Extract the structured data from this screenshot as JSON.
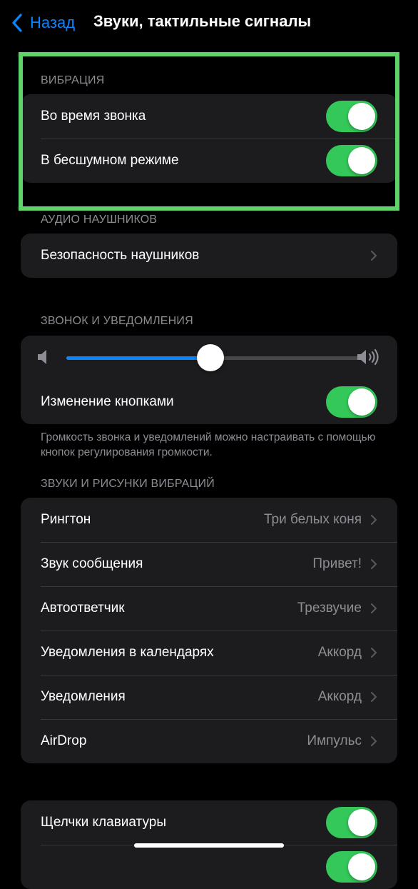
{
  "nav": {
    "back_label": "Назад",
    "title": "Звуки, тактильные сигналы"
  },
  "vibration": {
    "header": "ВИБРАЦИЯ",
    "items": [
      {
        "label": "Во время звонка",
        "on": true
      },
      {
        "label": "В бесшумном режиме",
        "on": true
      }
    ]
  },
  "headphones": {
    "header": "АУДИО НАУШНИКОВ",
    "items": [
      {
        "label": "Безопасность наушников"
      }
    ]
  },
  "ringer": {
    "header": "ЗВОНОК И УВЕДОМЛЕНИЯ",
    "volume": 0.49,
    "change_with_buttons": {
      "label": "Изменение кнопками",
      "on": true
    },
    "footnote": "Громкость звонка и уведомлений можно настраивать с помощью кнопок регулирования громкости."
  },
  "sounds": {
    "header": "ЗВУКИ И РИСУНКИ ВИБРАЦИЙ",
    "items": [
      {
        "label": "Рингтон",
        "value": "Три белых коня"
      },
      {
        "label": "Звук сообщения",
        "value": "Привет!"
      },
      {
        "label": "Автоответчик",
        "value": "Трезвучие"
      },
      {
        "label": "Уведомления в календарях",
        "value": "Аккорд"
      },
      {
        "label": "Уведомления",
        "value": "Аккорд"
      },
      {
        "label": "AirDrop",
        "value": "Импульс"
      }
    ]
  },
  "keyboard": {
    "items": [
      {
        "label": "Щелчки клавиатуры",
        "on": true
      },
      {
        "label": "",
        "on": true
      }
    ]
  },
  "colors": {
    "accent": "#0a84ff",
    "toggle_on": "#34c759",
    "highlight": "#5ed36a",
    "background": "#000000",
    "group_bg": "#1c1c1e"
  }
}
